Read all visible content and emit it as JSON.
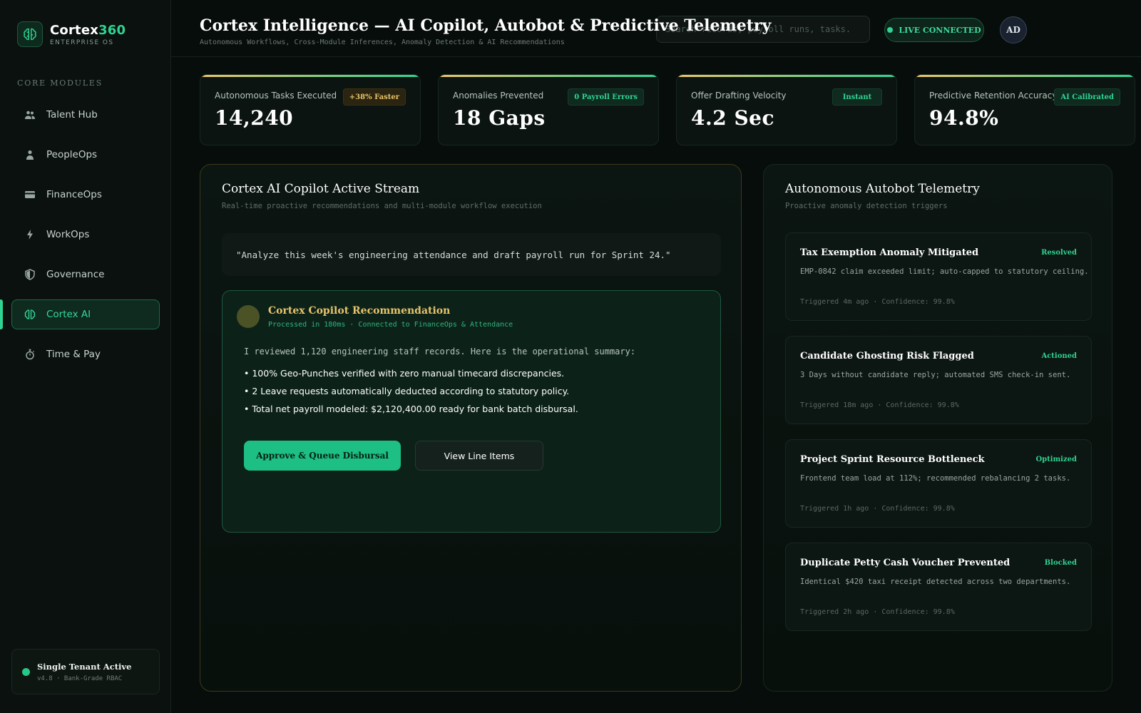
{
  "brand": {
    "name_main": "Cortex",
    "name_accent": "360",
    "subtitle": "ENTERPRISE OS"
  },
  "sidebar": {
    "section_label": "CORE MODULES",
    "items": [
      {
        "label": "Talent Hub",
        "icon": "people-icon"
      },
      {
        "label": "PeopleOps",
        "icon": "person-icon"
      },
      {
        "label": "FinanceOps",
        "icon": "card-icon"
      },
      {
        "label": "WorkOps",
        "icon": "bolt-icon"
      },
      {
        "label": "Governance",
        "icon": "shield-icon"
      },
      {
        "label": "Cortex AI",
        "icon": "brain-icon",
        "active": true
      },
      {
        "label": "Time & Pay",
        "icon": "stopwatch-icon"
      }
    ],
    "tenant": {
      "title": "Single Tenant Active",
      "subtitle": "v4.8 · Bank-Grade RBAC"
    }
  },
  "header": {
    "title": "Cortex Intelligence — AI Copilot, Autobot & Predictive Telemetry",
    "subtitle": "Autonomous Workflows, Cross-Module Inferences, Anomaly Detection & AI Recommendations",
    "search_placeholder": "Search records, payroll runs, tasks...",
    "live_label": "LIVE CONNECTED",
    "avatar_initials": "AD"
  },
  "kpis": [
    {
      "label": "Autonomous Tasks Executed",
      "value": "14,240",
      "badge": "+38% Faster",
      "badge_style": "gold"
    },
    {
      "label": "Anomalies Prevented",
      "value": "18 Gaps",
      "badge": "0 Payroll Errors",
      "badge_style": "green"
    },
    {
      "label": "Offer Drafting Velocity",
      "value": "4.2 Sec",
      "badge": "Instant",
      "badge_style": "green"
    },
    {
      "label": "Predictive Retention Accuracy",
      "value": "94.8%",
      "badge": "AI Calibrated",
      "badge_style": "green"
    }
  ],
  "copilot": {
    "title": "Cortex AI Copilot Active Stream",
    "subtitle": "Real-time proactive recommendations and multi-module workflow execution",
    "prompt": "\"Analyze this week's engineering attendance and draft payroll run for Sprint 24.\"",
    "recommendation": {
      "title": "Cortex Copilot Recommendation",
      "meta": "Processed in 180ms · Connected to FinanceOps & Attendance",
      "intro": "I reviewed 1,120 engineering staff records. Here is the operational summary:",
      "bullets": [
        "• 100% Geo-Punches verified with zero manual timecard discrepancies.",
        "• 2 Leave requests automatically deducted according to statutory policy.",
        "• Total net payroll modeled: $2,120,400.00 ready for bank batch disbursal."
      ],
      "approve_label": "Approve & Queue Disbursal",
      "view_label": "View Line Items"
    }
  },
  "telemetry": {
    "title": "Autonomous Autobot Telemetry",
    "subtitle": "Proactive anomaly detection triggers",
    "alerts": [
      {
        "title": "Tax Exemption Anomaly Mitigated",
        "status": "Resolved",
        "desc": "EMP-0842 claim exceeded limit; auto-capped to statutory ceiling.",
        "foot": "Triggered 4m ago · Confidence: 99.8%"
      },
      {
        "title": "Candidate Ghosting Risk Flagged",
        "status": "Actioned",
        "desc": "3 Days without candidate reply; automated SMS check-in sent.",
        "foot": "Triggered 18m ago · Confidence: 99.8%"
      },
      {
        "title": "Project Sprint Resource Bottleneck",
        "status": "Optimized",
        "desc": "Frontend team load at 112%; recommended rebalancing 2 tasks.",
        "foot": "Triggered 1h ago · Confidence: 99.8%"
      },
      {
        "title": "Duplicate Petty Cash Voucher Prevented",
        "status": "Blocked",
        "desc": "Identical $420 taxi receipt detected across two departments.",
        "foot": "Triggered 2h ago · Confidence: 99.8%"
      }
    ]
  },
  "colors": {
    "accent": "#2fd392",
    "gold": "#e9c46a",
    "background": "#070d0a"
  }
}
